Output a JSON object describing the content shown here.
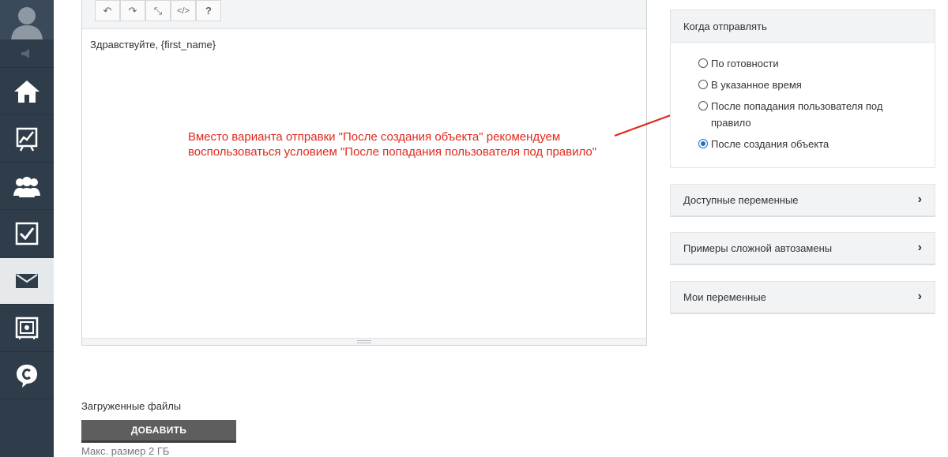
{
  "sidebar": {
    "icons": [
      "user-avatar-icon",
      "speaker-icon",
      "home-icon",
      "chart-icon",
      "users-icon",
      "checklist-icon",
      "mail-icon",
      "safe-icon",
      "chat-c-icon"
    ],
    "active": "mail-icon"
  },
  "editor": {
    "toolbar": [
      "↶",
      "↷",
      "⤡",
      "</>",
      "?"
    ],
    "content": "Здравствуйте, {first_name}"
  },
  "annotation": {
    "text": "Вместо варианта отправки \"После создания объекта\" рекомендуем воспользоваться условием \"После попадания пользователя под правило\"",
    "color": "#e0281e"
  },
  "files": {
    "title": "Загруженные файлы",
    "add_label": "ДОБАВИТЬ",
    "limit": "Макс. размер 2 ГБ"
  },
  "when_to_send": {
    "title": "Когда отправлять",
    "options": [
      {
        "label": "По готовности",
        "checked": false
      },
      {
        "label": "В указанное время",
        "checked": false
      },
      {
        "label": "После попадания пользователя под правило",
        "checked": false
      },
      {
        "label": "После создания объекта",
        "checked": true
      }
    ]
  },
  "accordions": [
    {
      "label": "Доступные переменные"
    },
    {
      "label": "Примеры сложной автозамены"
    },
    {
      "label": "Мои переменные"
    }
  ],
  "colors": {
    "sidebar": "#2f3d4b",
    "radio_checked": "#1d6fd6"
  }
}
